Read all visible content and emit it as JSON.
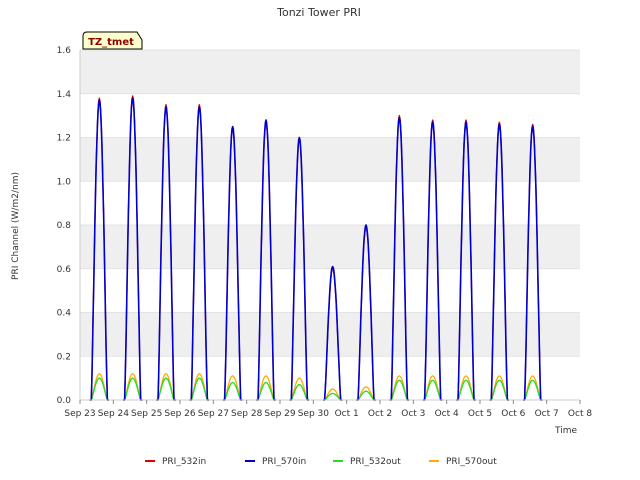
{
  "chart_data": {
    "type": "line",
    "title": "Tonzi Tower PRI",
    "xlabel": "Time",
    "ylabel": "PRI Channel (W/m2/nm)",
    "annotation": "TZ_tmet",
    "ylim": [
      0.0,
      1.6
    ],
    "yticks": [
      "0.0",
      "0.2",
      "0.4",
      "0.6",
      "0.8",
      "1.0",
      "1.2",
      "1.4",
      "1.6"
    ],
    "xlim": [
      "2023-09-23",
      "2023-10-08"
    ],
    "xticks": [
      "Sep 23",
      "Sep 24",
      "Sep 25",
      "Sep 26",
      "Sep 27",
      "Sep 28",
      "Sep 29",
      "Sep 30",
      "Oct 1",
      "Oct 2",
      "Oct 3",
      "Oct 4",
      "Oct 5",
      "Oct 6",
      "Oct 7",
      "Oct 8"
    ],
    "grid": true,
    "legend_position": "bottom",
    "days": [
      "2023-09-23",
      "2023-09-24",
      "2023-09-25",
      "2023-09-26",
      "2023-09-27",
      "2023-09-28",
      "2023-09-29",
      "2023-09-30",
      "2023-10-01",
      "2023-10-02",
      "2023-10-03",
      "2023-10-04",
      "2023-10-05",
      "2023-10-06",
      "2023-10-07"
    ],
    "series": [
      {
        "name": "PRI_532in",
        "color": "#dd0000",
        "daily_peak": [
          1.38,
          1.39,
          1.35,
          1.35,
          1.24,
          1.27,
          1.19,
          0.6,
          0.79,
          1.3,
          1.28,
          1.28,
          1.27,
          1.26
        ]
      },
      {
        "name": "PRI_570in",
        "color": "#0000cc",
        "daily_peak": [
          1.37,
          1.38,
          1.34,
          1.34,
          1.25,
          1.28,
          1.2,
          0.61,
          0.8,
          1.29,
          1.27,
          1.27,
          1.26,
          1.25
        ]
      },
      {
        "name": "PRI_532out",
        "color": "#22dd22",
        "daily_peak": [
          0.1,
          0.1,
          0.1,
          0.1,
          0.08,
          0.08,
          0.07,
          0.03,
          0.04,
          0.09,
          0.09,
          0.09,
          0.09,
          0.09
        ]
      },
      {
        "name": "PRI_570out",
        "color": "#ffaa00",
        "daily_peak": [
          0.12,
          0.12,
          0.12,
          0.12,
          0.11,
          0.11,
          0.1,
          0.05,
          0.06,
          0.11,
          0.11,
          0.11,
          0.11,
          0.11
        ]
      }
    ]
  }
}
